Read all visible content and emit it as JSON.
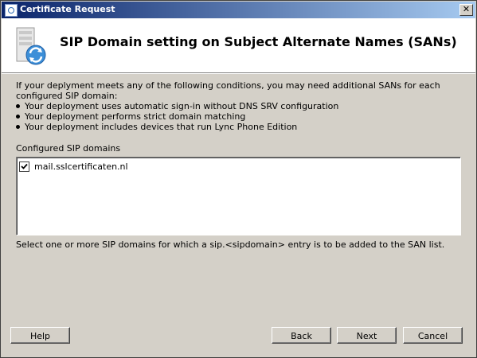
{
  "window": {
    "title": "Certificate Request",
    "close_glyph": "✕"
  },
  "header": {
    "title": "SIP Domain setting on Subject Alternate Names (SANs)",
    "icon": "server-certificate-icon"
  },
  "intro": "If your deplyment meets any of the following conditions, you may need additional SANs for each configured SIP domain:",
  "conditions": [
    "Your deployment uses automatic sign-in without DNS SRV configuration",
    "Your deployment performs strict domain matching",
    "Your deployment includes devices that run Lync Phone Edition"
  ],
  "sip_domains": {
    "label": "Configured SIP domains",
    "items": [
      {
        "label": "mail.sslcertificaten.nl",
        "checked": true
      }
    ]
  },
  "hint": "Select one or more SIP domains for which a sip.<sipdomain> entry is to be added to the SAN list.",
  "buttons": {
    "help": "Help",
    "back": "Back",
    "next": "Next",
    "cancel": "Cancel"
  }
}
